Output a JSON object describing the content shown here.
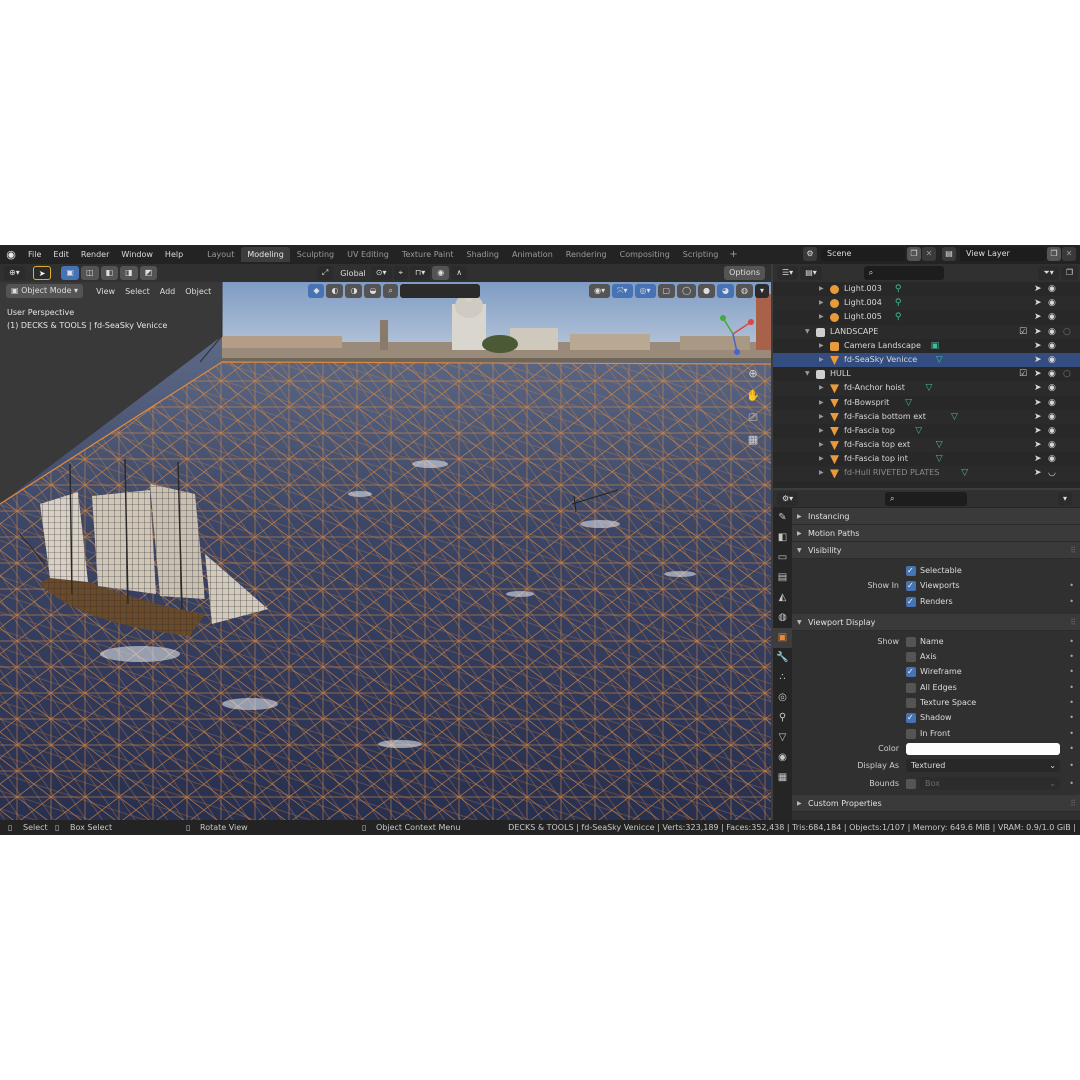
{
  "topbar": {
    "menus": [
      "File",
      "Edit",
      "Render",
      "Window",
      "Help"
    ],
    "workspaces": [
      {
        "label": "Layout",
        "active": false
      },
      {
        "label": "Modeling",
        "active": true
      },
      {
        "label": "Sculpting",
        "active": false
      },
      {
        "label": "UV Editing",
        "active": false
      },
      {
        "label": "Texture Paint",
        "active": false
      },
      {
        "label": "Shading",
        "active": false
      },
      {
        "label": "Animation",
        "active": false
      },
      {
        "label": "Rendering",
        "active": false
      },
      {
        "label": "Compositing",
        "active": false
      },
      {
        "label": "Scripting",
        "active": false
      }
    ],
    "add_workspace": "+",
    "scene": "Scene",
    "view_layer": "View Layer"
  },
  "viewport": {
    "transform_orientation": "Global",
    "options_label": "Options",
    "mode": "Object Mode",
    "menus": [
      "View",
      "Select",
      "Add",
      "Object"
    ],
    "info_line1": "User Perspective",
    "info_line2": "(1) DECKS & TOOLS | fd-SeaSky Venicce"
  },
  "outliner": {
    "rows": [
      {
        "label": "Light.003",
        "depth": 2,
        "icon": "light",
        "expand": true,
        "visible": true,
        "selected": false
      },
      {
        "label": "Light.004",
        "depth": 2,
        "icon": "light",
        "expand": true,
        "visible": true,
        "selected": false
      },
      {
        "label": "Light.005",
        "depth": 2,
        "icon": "light",
        "expand": true,
        "visible": true,
        "selected": false
      },
      {
        "label": "LANDSCAPE",
        "depth": 1,
        "icon": "collection",
        "expand": true,
        "visible": true,
        "selected": false,
        "collection": true
      },
      {
        "label": "Camera Landscape",
        "depth": 2,
        "icon": "camera",
        "expand": true,
        "visible": true,
        "selected": false
      },
      {
        "label": "fd-SeaSky Venicce",
        "depth": 2,
        "icon": "mesh",
        "expand": true,
        "visible": true,
        "selected": true
      },
      {
        "label": "HULL",
        "depth": 1,
        "icon": "collection",
        "expand": true,
        "visible": true,
        "selected": false,
        "collection": true
      },
      {
        "label": "fd-Anchor hoist",
        "depth": 2,
        "icon": "mesh",
        "expand": true,
        "visible": true,
        "selected": false
      },
      {
        "label": "fd-Bowsprit",
        "depth": 2,
        "icon": "mesh",
        "expand": true,
        "visible": true,
        "selected": false
      },
      {
        "label": "fd-Fascia bottom ext",
        "depth": 2,
        "icon": "mesh",
        "expand": true,
        "visible": true,
        "selected": false
      },
      {
        "label": "fd-Fascia top",
        "depth": 2,
        "icon": "mesh",
        "expand": true,
        "visible": true,
        "selected": false
      },
      {
        "label": "fd-Fascia top ext",
        "depth": 2,
        "icon": "mesh",
        "expand": true,
        "visible": true,
        "selected": false
      },
      {
        "label": "fd-Fascia top int",
        "depth": 2,
        "icon": "mesh",
        "expand": true,
        "visible": true,
        "selected": false
      },
      {
        "label": "fd-Hull RIVETED PLATES",
        "depth": 2,
        "icon": "mesh",
        "expand": true,
        "visible": false,
        "selected": false
      }
    ]
  },
  "properties": {
    "panels": {
      "instancing": "Instancing",
      "motion_paths": "Motion Paths",
      "visibility": "Visibility",
      "viewport_display": "Viewport Display",
      "custom_properties": "Custom Properties"
    },
    "visibility": {
      "selectable": "Selectable",
      "show_in_label": "Show In",
      "viewports": "Viewports",
      "renders": "Renders"
    },
    "viewport_display": {
      "show_label": "Show",
      "options": [
        {
          "label": "Name",
          "checked": false
        },
        {
          "label": "Axis",
          "checked": false
        },
        {
          "label": "Wireframe",
          "checked": true
        },
        {
          "label": "All Edges",
          "checked": false
        },
        {
          "label": "Texture Space",
          "checked": false
        },
        {
          "label": "Shadow",
          "checked": true
        },
        {
          "label": "In Front",
          "checked": false
        }
      ],
      "color_label": "Color",
      "display_as_label": "Display As",
      "display_as_value": "Textured",
      "bounds_label": "Bounds",
      "bounds_value": "Box"
    }
  },
  "statusbar": {
    "select": "Select",
    "box_select": "Box Select",
    "rotate_view": "Rotate View",
    "context_menu": "Object Context Menu",
    "stats": "DECKS & TOOLS | fd-SeaSky Venicce | Verts:323,189 | Faces:352,438 | Tris:684,184 | Objects:1/107 | Memory: 649.6 MiB | VRAM: 0.9/1.0 GiB |"
  },
  "colors": {
    "wire": "#e08a3c",
    "selection_blue": "#4772b3",
    "accent_green": "#3fbf9f",
    "ui_dark": "#232323"
  }
}
